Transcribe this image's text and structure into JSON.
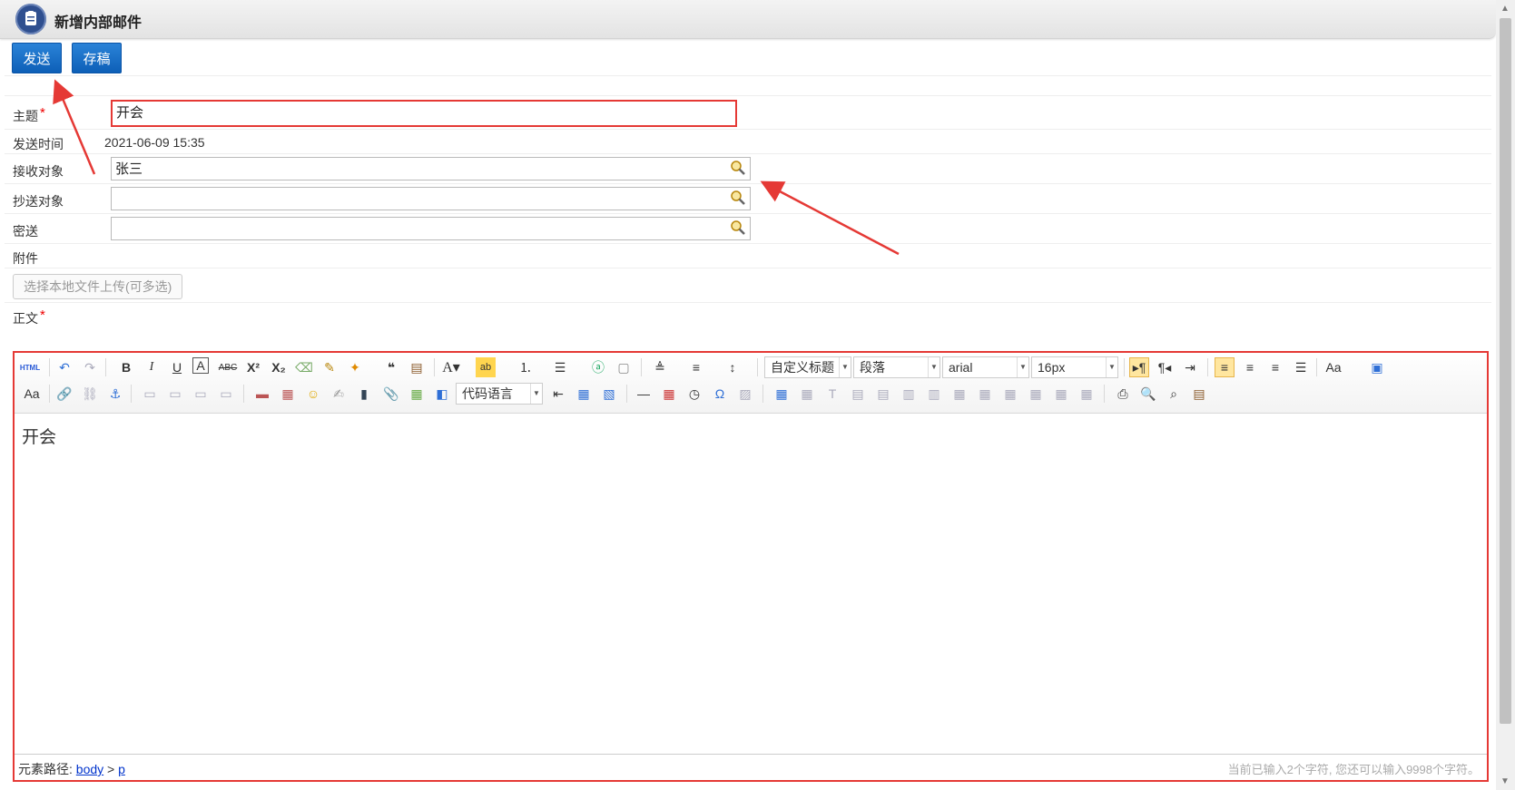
{
  "window": {
    "title": "新增内部邮件"
  },
  "actions": {
    "send": "发送",
    "draft": "存稿"
  },
  "form": {
    "subject_label": "主题",
    "subject_value": "开会",
    "send_time_label": "发送时间",
    "send_time_value": "2021-06-09 15:35",
    "to_label": "接收对象",
    "to_value": "张三",
    "cc_label": "抄送对象",
    "cc_value": "",
    "bcc_label": "密送",
    "bcc_value": "",
    "attachment_label": "附件",
    "upload_button": "选择本地文件上传(可多选)",
    "body_label": "正文",
    "required_mark": "*"
  },
  "editor": {
    "combo_heading": "自定义标题",
    "combo_paragraph": "段落",
    "combo_font": "arial",
    "combo_size": "16px",
    "combo_code": "代码语言",
    "content": "开会",
    "path_label": "元素路径:",
    "path_body": "body",
    "path_sep": ">",
    "path_p": "p",
    "char_count": "当前已输入2个字符, 您还可以输入9998个字符。"
  },
  "colors": {
    "accent": "#0d5fb7",
    "highlight": "#e53935"
  }
}
